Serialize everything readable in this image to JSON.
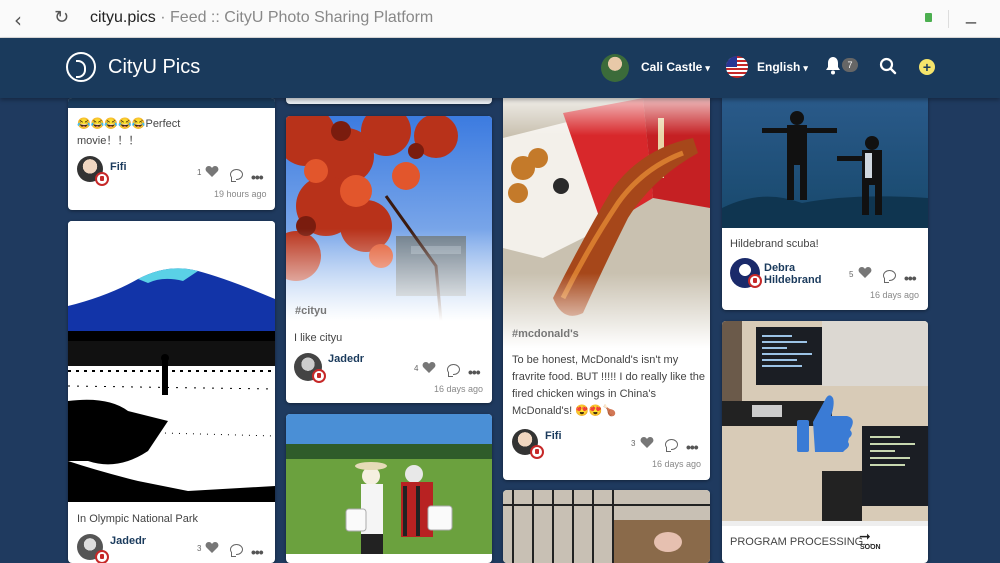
{
  "browser": {
    "host": "cityu.pics",
    "title": " · Feed :: CityU Photo Sharing Platform"
  },
  "header": {
    "brand": "CityU Pics",
    "user": "Cali Castle",
    "language": "English",
    "notifications": "7"
  },
  "posts": [
    {
      "caption": "😂😂😂😂😂Perfect movie！！！",
      "user": "Fifi",
      "likes": "1",
      "time": "19 hours ago"
    },
    {
      "caption": "In Olympic National Park",
      "user": "Jadedr",
      "likes": "3"
    },
    {
      "tag": "#cityu",
      "caption": "I like cityu",
      "user": "Jadedr",
      "likes": "4",
      "time": "16 days ago"
    },
    {
      "tag": "#mcdonald's",
      "caption": "To be honest, McDonald's isn't my fravrite food. BUT !!!!! I do really like the fired chicken wings in China's McDonald's! 😍😍🍗",
      "user": "Fifi",
      "likes": "3",
      "time": "16 days ago"
    },
    {
      "caption": "Hildebrand scuba!",
      "user": "Debra Hildebrand",
      "likes": "5",
      "time": "16 days ago"
    },
    {
      "caption": "PROGRAM PROCESSING...",
      "soon": "SOON"
    }
  ],
  "colors": {
    "navy": "#1a3a5c",
    "page": "#1f3a5f",
    "accent": "#f5e46b",
    "report": "#c62828",
    "thumb": "#3a7bd5"
  }
}
